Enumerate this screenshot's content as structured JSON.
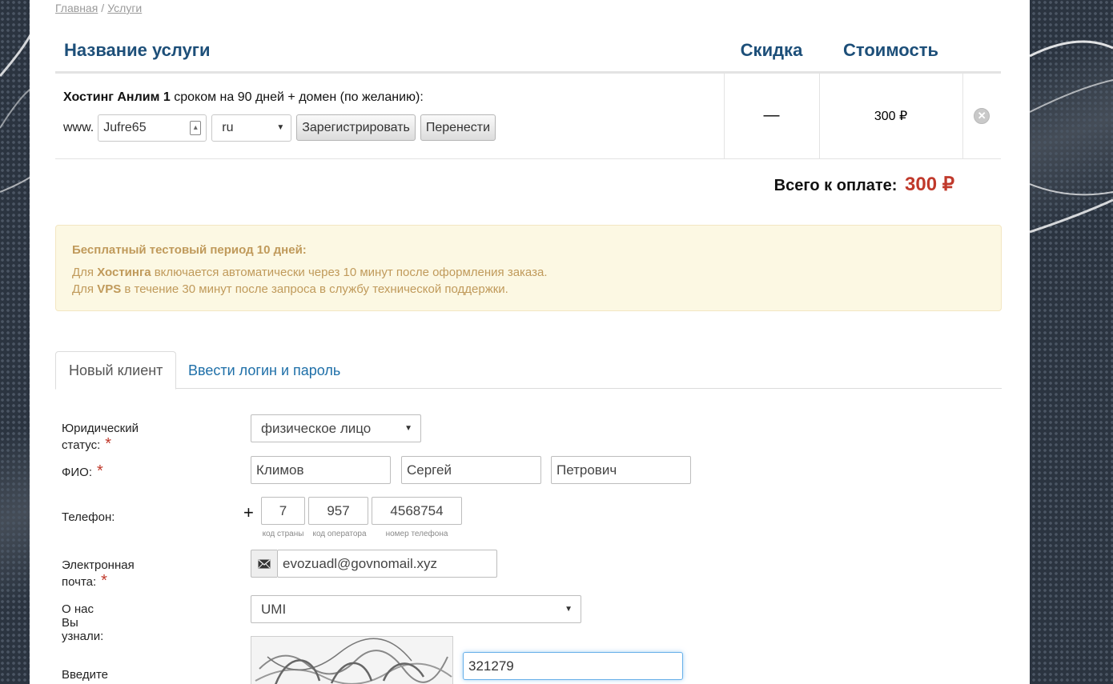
{
  "breadcrumb": {
    "home": "Главная",
    "sep": "/",
    "current": "Услуги"
  },
  "cart": {
    "headers": {
      "service": "Название услуги",
      "discount": "Скидка",
      "cost": "Стоимость"
    },
    "item": {
      "name_bold": "Хостинг Анлим 1",
      "name_rest": " сроком на 90 дней + домен (по желанию):",
      "www": "www.",
      "domain_value": "Jufre65",
      "zone": "ru",
      "register_label": "Зарегистрировать",
      "transfer_label": "Перенести",
      "discount": "—",
      "price": "300 ₽"
    },
    "total_label": "Всего к оплате:",
    "total_amount": "300 ₽"
  },
  "notice": {
    "title": "Бесплатный тестовый период 10 дней:",
    "line1_pre": "Для ",
    "line1_bold": "Хостинга",
    "line1_post": " включается автоматически через 10 минут после оформления заказа.",
    "line2_pre": "Для ",
    "line2_bold": "VPS",
    "line2_post": " в течение 30 минут после запроса в службу технической поддержки."
  },
  "tabs": {
    "new_client": "Новый клиент",
    "login": "Ввести логин и пароль"
  },
  "form": {
    "legal_status_label": "Юридический статус:",
    "legal_status_value": "физическое лицо",
    "fio_label": "ФИО:",
    "last_name": "Климов",
    "first_name": "Сергей",
    "middle_name": "Петрович",
    "phone_label": "Телефон:",
    "phone_plus": "+",
    "phone_country": "7",
    "phone_operator": "957",
    "phone_number": "4568754",
    "hint_country": "код страны",
    "hint_operator": "код оператора",
    "hint_number": "номер телефона",
    "email_label": "Электронная почта:",
    "email_value": "evozuadl@govnomail.xyz",
    "source_label": "О нас Вы узнали:",
    "source_value": "UMI",
    "captcha_label": "Введите код:",
    "captcha_value": "321279",
    "required_mark": "*"
  },
  "colors": {
    "heading": "#1d4f79",
    "price": "#c0392b",
    "link": "#1e6fa8",
    "notice_bg": "#fcf8e3"
  }
}
